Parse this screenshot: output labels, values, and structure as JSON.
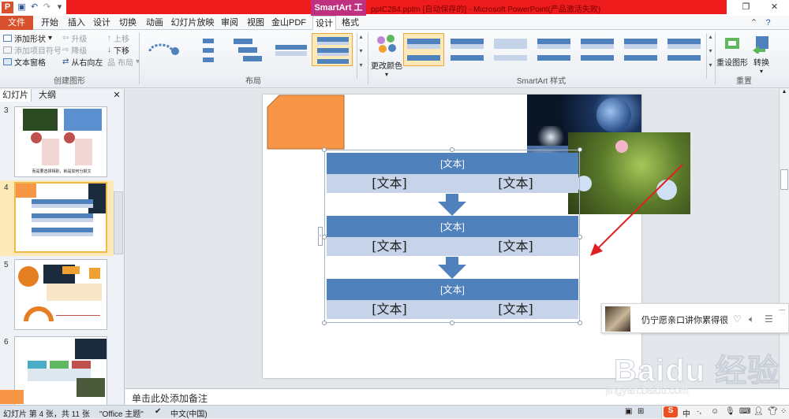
{
  "titlebar": {
    "contextual_tab": "SmartArt 工具",
    "window_title": "pptC284.pptm [自动保存的] - Microsoft PowerPoint(产品激活失败)"
  },
  "tabs": [
    "文件",
    "开始",
    "插入",
    "设计",
    "切换",
    "动画",
    "幻灯片放映",
    "审阅",
    "视图",
    "金山PDF",
    "设计",
    "格式"
  ],
  "active_tab": "设计",
  "ribbon": {
    "create": {
      "add_shape": "添加形状",
      "add_bullet": "添加项目符号",
      "text_pane": "文本窗格",
      "promote": "升级",
      "demote": "降级",
      "right_to_left": "从右向左",
      "move_up": "上移",
      "move_down": "下移",
      "layout": "布局",
      "label": "创建图形"
    },
    "layouts_label": "布局",
    "change_colors": "更改颜色",
    "styles_label": "SmartArt 样式",
    "reset_graphic": "重设图形",
    "convert": "转换",
    "reset_label": "重置"
  },
  "leftpane": {
    "tab_slides": "幻灯片",
    "tab_outline": "大纲",
    "thumbs": [
      {
        "num": "3",
        "caption": "而是要选择相别，就是如何分颜文"
      },
      {
        "num": "4"
      },
      {
        "num": "5"
      },
      {
        "num": "6"
      }
    ]
  },
  "smartart": {
    "rows": [
      {
        "head": "[文本]",
        "left": "[文本]",
        "right": "[文本]"
      },
      {
        "head": "[文本]",
        "left": "[文本]",
        "right": "[文本]"
      },
      {
        "head": "[文本]",
        "left": "[文本]",
        "right": "[文本]"
      }
    ],
    "colors": {
      "accent": "#4f81bd",
      "light": "#c6d3e8",
      "shape_orange": "#f79646",
      "arrow_red": "#e02020"
    }
  },
  "notes_placeholder": "单击此处添加备注",
  "status": {
    "slide": "幻灯片 第 4 张，共 11 张",
    "theme": "\"Office 主题\"",
    "language": "中文(中国)"
  },
  "music": {
    "title": "仍宁愿亲口讲你累得很"
  },
  "watermark": {
    "brand": "Baidu 经验",
    "url": "jingyan.baidu.com"
  }
}
